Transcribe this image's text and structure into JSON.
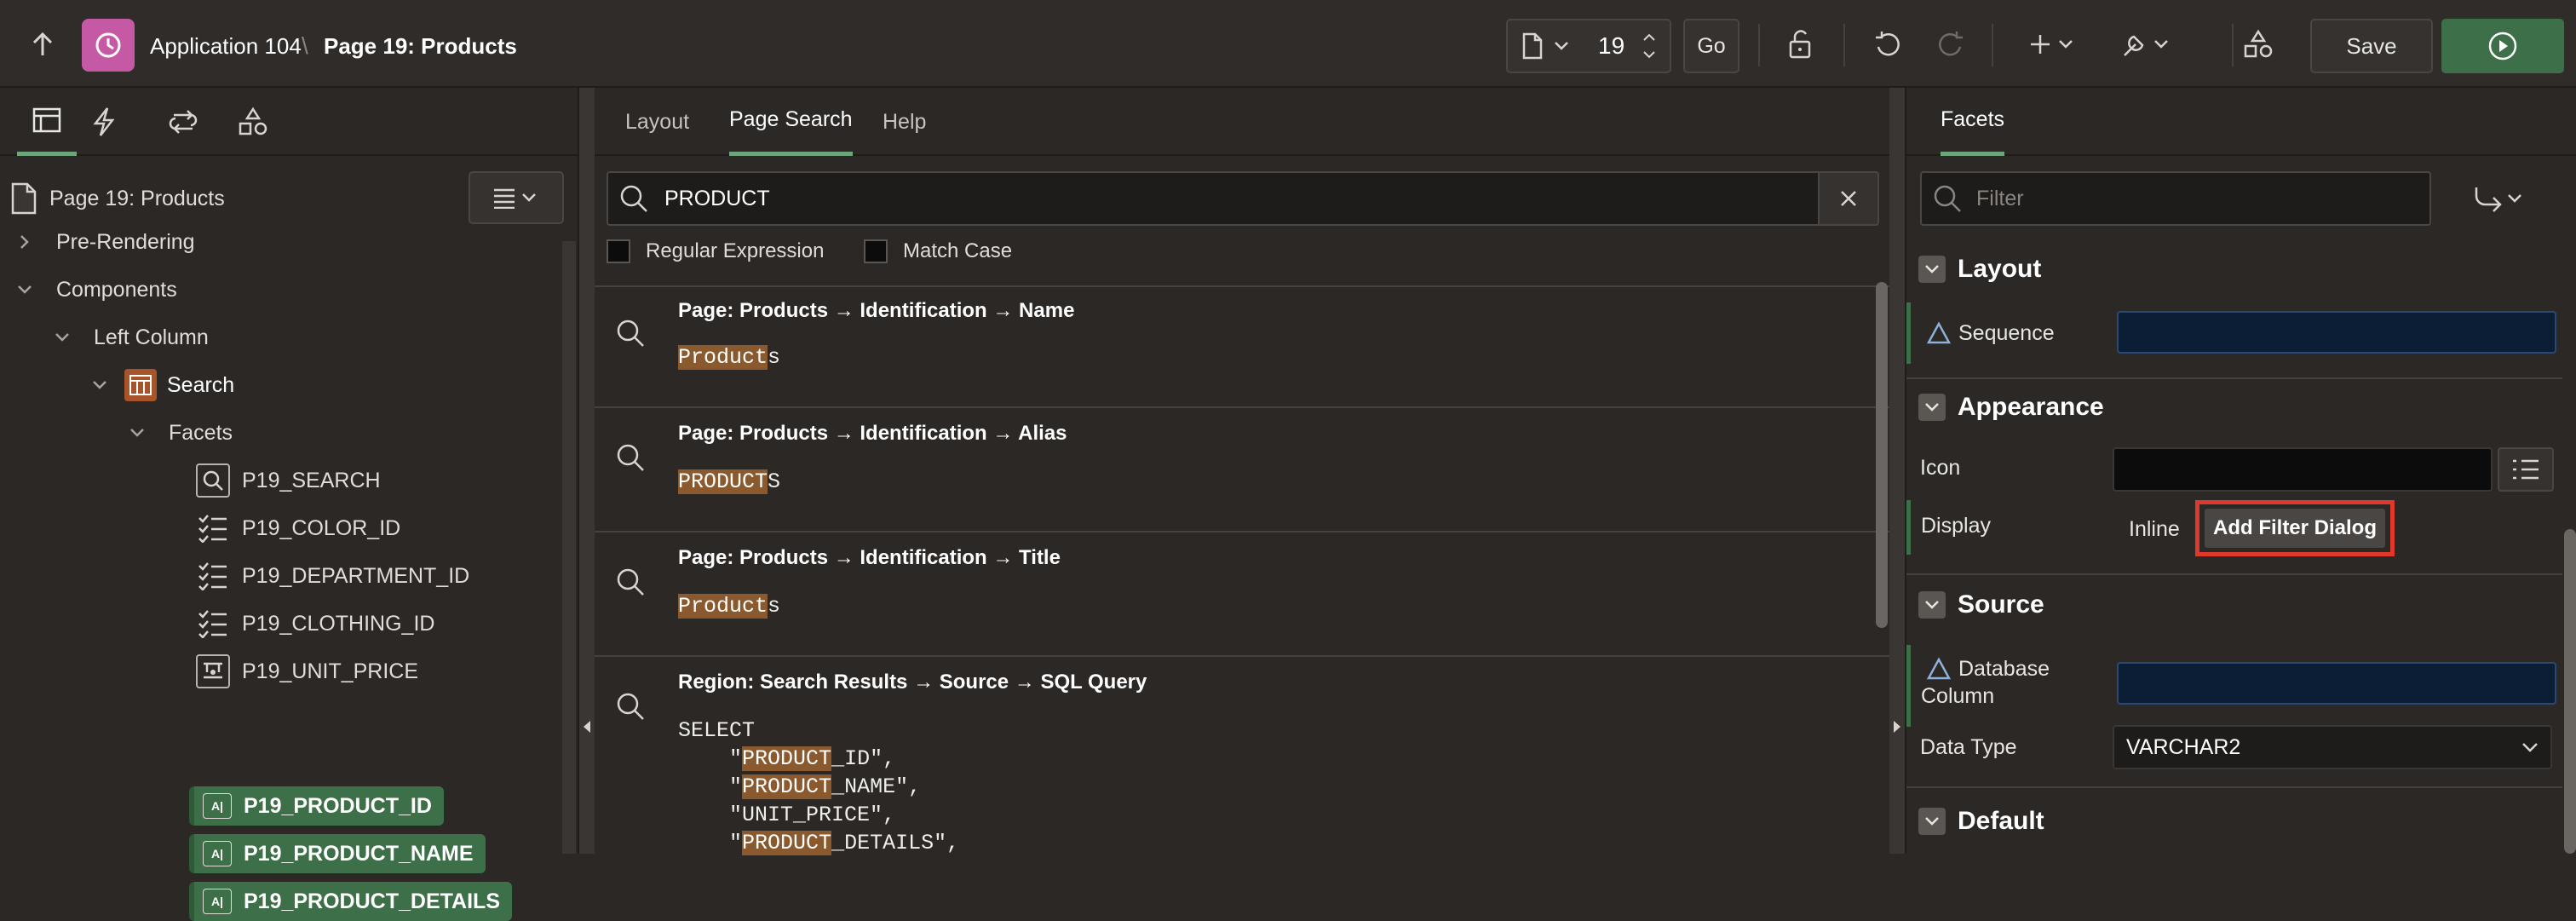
{
  "header": {
    "app_name": "Application 104",
    "separator": "\\",
    "page_name": "Page 19: Products",
    "page_number": "19",
    "go_label": "Go",
    "save_label": "Save"
  },
  "left_panel": {
    "root_label": "Page 19: Products",
    "tree": [
      {
        "label": "Pre-Rendering"
      },
      {
        "label": "Components"
      },
      {
        "label": "Left Column"
      },
      {
        "label": "Search"
      },
      {
        "label": "Facets"
      },
      {
        "label": "P19_SEARCH"
      },
      {
        "label": "P19_COLOR_ID"
      },
      {
        "label": "P19_DEPARTMENT_ID"
      },
      {
        "label": "P19_CLOTHING_ID"
      },
      {
        "label": "P19_UNIT_PRICE"
      },
      {
        "label": "P19_PRODUCT_ID"
      },
      {
        "label": "P19_PRODUCT_NAME"
      },
      {
        "label": "P19_PRODUCT_DETAILS"
      }
    ]
  },
  "middle_panel": {
    "tabs": [
      {
        "label": "Layout"
      },
      {
        "label": "Page Search"
      },
      {
        "label": "Help"
      }
    ],
    "search_value": "PRODUCT",
    "option_regex": "Regular Expression",
    "option_match_case": "Match Case",
    "results": [
      {
        "title": "Page: Products → Identification → Name",
        "hl": "Product",
        "rest": "s"
      },
      {
        "title": "Page: Products → Identification → Alias",
        "hl": "PRODUCT",
        "rest": "S"
      },
      {
        "title": "Page: Products → Identification → Title",
        "hl": "Product",
        "rest": "s"
      },
      {
        "title": "Region: Search Results → Source → SQL Query"
      }
    ],
    "sql": {
      "line1": "SELECT",
      "l2_pre": "\"",
      "l2_hl": "PRODUCT",
      "l2_post": "_ID\",",
      "l3_pre": "\"",
      "l3_hl": "PRODUCT",
      "l3_post": "_NAME\",",
      "l4": "\"UNIT_PRICE\",",
      "l5_pre": "\"",
      "l5_hl": "PRODUCT",
      "l5_post": "_DETAILS\","
    }
  },
  "right_panel": {
    "tab": "Facets",
    "filter_placeholder": "Filter",
    "sections": {
      "layout": "Layout",
      "appearance": "Appearance",
      "source": "Source",
      "default": "Default"
    },
    "props": {
      "sequence": "Sequence",
      "icon": "Icon",
      "display": "Display",
      "display_inline": "Inline",
      "display_dialog": "Add Filter Dialog",
      "database_column_1": "Database",
      "database_column_2": "Column",
      "data_type": "Data Type",
      "data_type_value": "VARCHAR2"
    }
  },
  "colors": {
    "accent_green": "#3d7048",
    "app_icon": "#c659a6",
    "highlight": "#8a5a2e",
    "focus_outline": "#e0392b"
  }
}
